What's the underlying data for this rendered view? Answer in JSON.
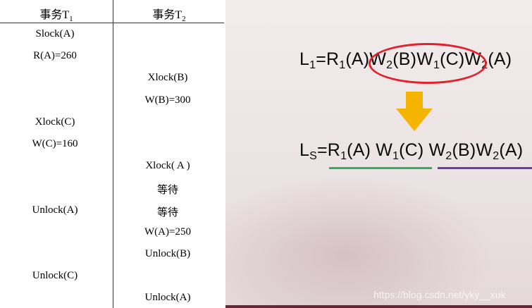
{
  "table": {
    "headers": {
      "t1_main": "事务T",
      "t1_sub": "1",
      "t2_main": "事务T",
      "t2_sub": "2"
    },
    "rows": [
      {
        "t1": "Slock(A)",
        "t2": ""
      },
      {
        "t1": "R(A)=260",
        "t2": ""
      },
      {
        "t1": "",
        "t2": "Xlock(B)"
      },
      {
        "t1": "",
        "t2": "W(B)=300"
      },
      {
        "t1": "Xlock(C)",
        "t2": ""
      },
      {
        "t1": "W(C)=160",
        "t2": ""
      },
      {
        "t1": "",
        "t2": "Xlock( A )"
      },
      {
        "t1": "",
        "t2": "等待"
      },
      {
        "t1": "Unlock(A)",
        "t2": "等待"
      },
      {
        "t1": "",
        "t2": "W(A)=250"
      },
      {
        "t1": "",
        "t2": "Unlock(B)"
      },
      {
        "t1": "Unlock(C)",
        "t2": ""
      },
      {
        "t1": "",
        "t2": "Unlock(A)"
      }
    ]
  },
  "slide": {
    "l1": {
      "lhs": "L",
      "lhs_sub": "1",
      "eq": "=",
      "terms": [
        {
          "op": "R",
          "sub": "1",
          "arg": "(A)"
        },
        {
          "op": "W",
          "sub": "2",
          "arg": "(B)"
        },
        {
          "op": "W",
          "sub": "1",
          "arg": "(C)"
        },
        {
          "op": "W",
          "sub": "2",
          "arg": "(A)"
        }
      ]
    },
    "ls": {
      "lhs": "L",
      "lhs_sub": "S",
      "eq": "=",
      "terms": [
        {
          "op": "R",
          "sub": "1",
          "arg": "(A) "
        },
        {
          "op": "W",
          "sub": "1",
          "arg": "(C) "
        },
        {
          "op": "W",
          "sub": "2",
          "arg": "(B)"
        },
        {
          "op": "W",
          "sub": "2",
          "arg": "(A)"
        }
      ]
    },
    "colors": {
      "ellipse": "#e3212b",
      "arrow": "#f5b400",
      "underline_t1": "#2fb05a",
      "underline_t2": "#6b3ea3"
    },
    "watermark": "https://blog.csdn.net/yky__xuk"
  }
}
